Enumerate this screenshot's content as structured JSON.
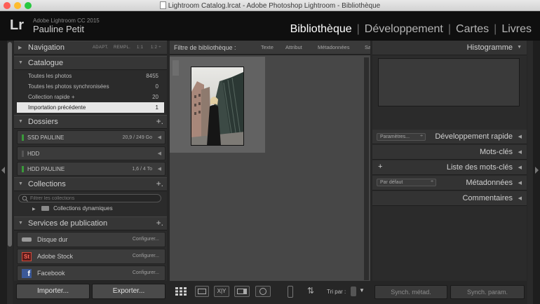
{
  "window": {
    "title": "Lightroom Catalog.lrcat - Adobe Photoshop Lightroom - Bibliothèque",
    "traffic_light_colors": [
      "#fe5f57",
      "#febc2e",
      "#28c840"
    ]
  },
  "identity": {
    "logo": "Lr",
    "app_version": "Adobe Lightroom CC 2015",
    "user_name": "Pauline Petit"
  },
  "modules": [
    "Bibliothèque",
    "Développement",
    "Cartes",
    "Livres"
  ],
  "module_separator": "|",
  "left_panel": {
    "navigation": {
      "title": "Navigation",
      "zoom_options": [
        "ADAPT.",
        "REMPL.",
        "1:1",
        "1:2 ÷"
      ]
    },
    "catalogue": {
      "title": "Catalogue",
      "items": [
        {
          "label": "Toutes les photos",
          "count": "8455"
        },
        {
          "label": "Toutes les photos synchronisées",
          "count": "0"
        },
        {
          "label": "Collection rapide +",
          "count": "20"
        },
        {
          "label": "Importation précédente",
          "count": "1",
          "selected": true
        }
      ]
    },
    "dossiers": {
      "title": "Dossiers",
      "plus": "+.",
      "drives": [
        {
          "label": "SSD PAULINE",
          "capacity": "20,9 / 249 Go",
          "online": true
        },
        {
          "label": "HDD",
          "capacity": "",
          "online": false
        },
        {
          "label": "HDD PAULINE",
          "capacity": "1,6 / 4 To",
          "online": true
        }
      ]
    },
    "collections": {
      "title": "Collections",
      "plus": "+.",
      "filter_placeholder": "Filtrer les collections",
      "items": [
        {
          "label": "Collections dynamiques"
        }
      ]
    },
    "services": {
      "title": "Services de publication",
      "plus": "+.",
      "items": [
        {
          "label": "Disque dur",
          "action": "Configurer...",
          "icon": "hard-drive-icon"
        },
        {
          "label": "Adobe Stock",
          "action": "Configurer...",
          "icon": "adobe-stock-icon",
          "icon_text": "St"
        },
        {
          "label": "Facebook",
          "action": "Configurer...",
          "icon": "facebook-icon",
          "icon_text": "f"
        }
      ]
    },
    "import_button": "Importer...",
    "export_button": "Exporter..."
  },
  "filter_bar": {
    "title": "Filtre de bibliothèque :",
    "options": [
      "Texte",
      "Attribut",
      "Métadonnées",
      "Sa"
    ]
  },
  "toolbar": {
    "sort_label": "Tri par :"
  },
  "right_panel": {
    "histogram": {
      "title": "Histogramme"
    },
    "quick_develop": {
      "title": "Développement rapide",
      "preset": "Paramètres..."
    },
    "keywords": {
      "title": "Mots-clés"
    },
    "keyword_list": {
      "title": "Liste des mots-clés",
      "plus": "+"
    },
    "metadata": {
      "title": "Métadonnées",
      "preset": "Par défaut"
    },
    "comments": {
      "title": "Commentaires"
    },
    "sync_meta_button": "Synch. métad.",
    "sync_settings_button": "Synch. param."
  }
}
